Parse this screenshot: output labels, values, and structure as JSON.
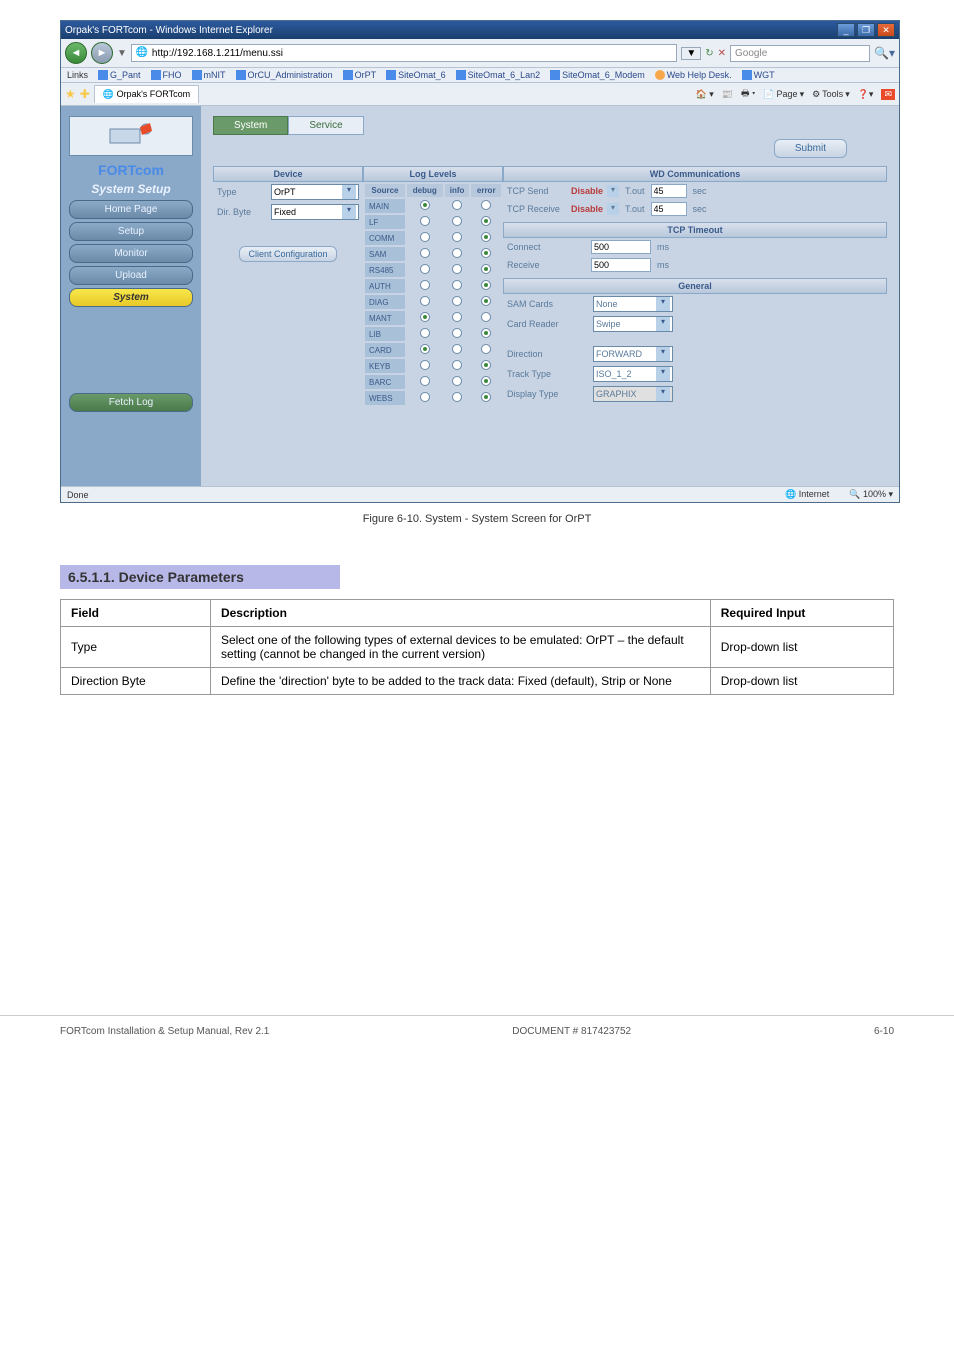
{
  "browser": {
    "title": "Orpak's FORTcom - Windows Internet Explorer",
    "url": "http://192.168.1.211/menu.ssi",
    "search_placeholder": "Google",
    "status_left": "Done",
    "status_zone": "Internet",
    "status_zoom": "100%",
    "links": [
      "G_Pant",
      "FHO",
      "mNIT",
      "OrCU_Administration",
      "OrPT",
      "SiteOmat_6",
      "SiteOmat_6_Lan2",
      "SiteOmat_6_Modem",
      "Web Help Desk.",
      "WGT"
    ],
    "tab_name": "Orpak's FORTcom",
    "toolbar": {
      "page": "Page",
      "tools": "Tools"
    }
  },
  "sidebar": {
    "brand": "FORTcom",
    "heading": "System Setup",
    "items": [
      {
        "label": "Home Page"
      },
      {
        "label": "Setup"
      },
      {
        "label": "Monitor"
      },
      {
        "label": "Upload"
      },
      {
        "label": "System"
      }
    ],
    "fetch_log": "Fetch Log"
  },
  "content": {
    "tabs": {
      "system": "System",
      "service": "Service"
    },
    "submit": "Submit",
    "device": {
      "header": "Device",
      "type_label": "Type",
      "type_value": "OrPT",
      "dir_label": "Dir. Byte",
      "dir_value": "Fixed",
      "client_config": "Client Configuration"
    },
    "log": {
      "header": "Log Levels",
      "cols": {
        "source": "Source",
        "debug": "debug",
        "info": "info",
        "error": "error"
      },
      "rows": [
        {
          "src": "MAIN",
          "sel": "debug"
        },
        {
          "src": "LF",
          "sel": "error"
        },
        {
          "src": "COMM",
          "sel": "error"
        },
        {
          "src": "SAM",
          "sel": "error"
        },
        {
          "src": "RS485",
          "sel": "error"
        },
        {
          "src": "AUTH",
          "sel": "error"
        },
        {
          "src": "DIAG",
          "sel": "error"
        },
        {
          "src": "MANT",
          "sel": "debug"
        },
        {
          "src": "LIB",
          "sel": "error"
        },
        {
          "src": "CARD",
          "sel": "debug"
        },
        {
          "src": "KEYB",
          "sel": "error"
        },
        {
          "src": "BARC",
          "sel": "error"
        },
        {
          "src": "WEBS",
          "sel": "error"
        }
      ]
    },
    "wd": {
      "header": "WD Communications",
      "send_label": "TCP Send",
      "send_status": "Disable",
      "send_tout": "45",
      "recv_label": "TCP Receive",
      "recv_status": "Disable",
      "recv_tout": "45",
      "tout_label": "T.out",
      "sec": "sec"
    },
    "tcp": {
      "header": "TCP Timeout",
      "connect_label": "Connect",
      "connect_val": "500",
      "receive_label": "Receive",
      "receive_val": "500",
      "ms": "ms"
    },
    "general": {
      "header": "General",
      "rows": [
        {
          "label": "SAM Cards",
          "value": "None"
        },
        {
          "label": "Card Reader",
          "value": "Swipe"
        },
        {
          "label_spacer": true
        },
        {
          "label": "Direction",
          "value": "FORWARD"
        },
        {
          "label": "Track Type",
          "value": "ISO_1_2"
        },
        {
          "label": "Display Type",
          "value": "GRAPHIX",
          "disabled": true
        }
      ]
    }
  },
  "caption": "Figure 6-10. System - System Screen for OrPT",
  "section_heading": "6.5.1.1. Device Parameters",
  "table": {
    "col1": "Field",
    "col2": "Description",
    "col3": "Required Input",
    "rows": [
      {
        "field": "Type",
        "desc": "Select one of the following types of external devices to be emulated: OrPT – the default setting (cannot be changed in the current version)",
        "input": "Drop-down list"
      },
      {
        "field": "Direction Byte",
        "desc": "Define the 'direction' byte to be added to the track data: Fixed (default), Strip or None",
        "input": "Drop-down list"
      }
    ]
  },
  "footer": {
    "left": "FORTcom Installation & Setup Manual, Rev 2.1",
    "center": "DOCUMENT # 817423752",
    "right": "6-10"
  }
}
